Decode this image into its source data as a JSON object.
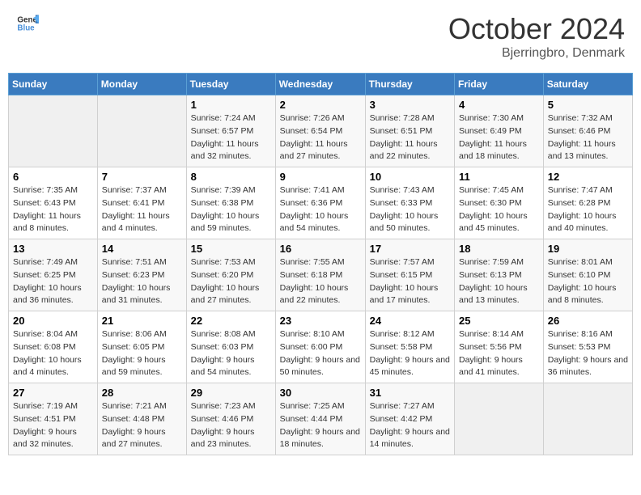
{
  "header": {
    "logo_general": "General",
    "logo_blue": "Blue",
    "month": "October 2024",
    "location": "Bjerringbro, Denmark"
  },
  "weekdays": [
    "Sunday",
    "Monday",
    "Tuesday",
    "Wednesday",
    "Thursday",
    "Friday",
    "Saturday"
  ],
  "weeks": [
    [
      {
        "day": "",
        "sunrise": "",
        "sunset": "",
        "daylight": ""
      },
      {
        "day": "",
        "sunrise": "",
        "sunset": "",
        "daylight": ""
      },
      {
        "day": "1",
        "sunrise": "Sunrise: 7:24 AM",
        "sunset": "Sunset: 6:57 PM",
        "daylight": "Daylight: 11 hours and 32 minutes."
      },
      {
        "day": "2",
        "sunrise": "Sunrise: 7:26 AM",
        "sunset": "Sunset: 6:54 PM",
        "daylight": "Daylight: 11 hours and 27 minutes."
      },
      {
        "day": "3",
        "sunrise": "Sunrise: 7:28 AM",
        "sunset": "Sunset: 6:51 PM",
        "daylight": "Daylight: 11 hours and 22 minutes."
      },
      {
        "day": "4",
        "sunrise": "Sunrise: 7:30 AM",
        "sunset": "Sunset: 6:49 PM",
        "daylight": "Daylight: 11 hours and 18 minutes."
      },
      {
        "day": "5",
        "sunrise": "Sunrise: 7:32 AM",
        "sunset": "Sunset: 6:46 PM",
        "daylight": "Daylight: 11 hours and 13 minutes."
      }
    ],
    [
      {
        "day": "6",
        "sunrise": "Sunrise: 7:35 AM",
        "sunset": "Sunset: 6:43 PM",
        "daylight": "Daylight: 11 hours and 8 minutes."
      },
      {
        "day": "7",
        "sunrise": "Sunrise: 7:37 AM",
        "sunset": "Sunset: 6:41 PM",
        "daylight": "Daylight: 11 hours and 4 minutes."
      },
      {
        "day": "8",
        "sunrise": "Sunrise: 7:39 AM",
        "sunset": "Sunset: 6:38 PM",
        "daylight": "Daylight: 10 hours and 59 minutes."
      },
      {
        "day": "9",
        "sunrise": "Sunrise: 7:41 AM",
        "sunset": "Sunset: 6:36 PM",
        "daylight": "Daylight: 10 hours and 54 minutes."
      },
      {
        "day": "10",
        "sunrise": "Sunrise: 7:43 AM",
        "sunset": "Sunset: 6:33 PM",
        "daylight": "Daylight: 10 hours and 50 minutes."
      },
      {
        "day": "11",
        "sunrise": "Sunrise: 7:45 AM",
        "sunset": "Sunset: 6:30 PM",
        "daylight": "Daylight: 10 hours and 45 minutes."
      },
      {
        "day": "12",
        "sunrise": "Sunrise: 7:47 AM",
        "sunset": "Sunset: 6:28 PM",
        "daylight": "Daylight: 10 hours and 40 minutes."
      }
    ],
    [
      {
        "day": "13",
        "sunrise": "Sunrise: 7:49 AM",
        "sunset": "Sunset: 6:25 PM",
        "daylight": "Daylight: 10 hours and 36 minutes."
      },
      {
        "day": "14",
        "sunrise": "Sunrise: 7:51 AM",
        "sunset": "Sunset: 6:23 PM",
        "daylight": "Daylight: 10 hours and 31 minutes."
      },
      {
        "day": "15",
        "sunrise": "Sunrise: 7:53 AM",
        "sunset": "Sunset: 6:20 PM",
        "daylight": "Daylight: 10 hours and 27 minutes."
      },
      {
        "day": "16",
        "sunrise": "Sunrise: 7:55 AM",
        "sunset": "Sunset: 6:18 PM",
        "daylight": "Daylight: 10 hours and 22 minutes."
      },
      {
        "day": "17",
        "sunrise": "Sunrise: 7:57 AM",
        "sunset": "Sunset: 6:15 PM",
        "daylight": "Daylight: 10 hours and 17 minutes."
      },
      {
        "day": "18",
        "sunrise": "Sunrise: 7:59 AM",
        "sunset": "Sunset: 6:13 PM",
        "daylight": "Daylight: 10 hours and 13 minutes."
      },
      {
        "day": "19",
        "sunrise": "Sunrise: 8:01 AM",
        "sunset": "Sunset: 6:10 PM",
        "daylight": "Daylight: 10 hours and 8 minutes."
      }
    ],
    [
      {
        "day": "20",
        "sunrise": "Sunrise: 8:04 AM",
        "sunset": "Sunset: 6:08 PM",
        "daylight": "Daylight: 10 hours and 4 minutes."
      },
      {
        "day": "21",
        "sunrise": "Sunrise: 8:06 AM",
        "sunset": "Sunset: 6:05 PM",
        "daylight": "Daylight: 9 hours and 59 minutes."
      },
      {
        "day": "22",
        "sunrise": "Sunrise: 8:08 AM",
        "sunset": "Sunset: 6:03 PM",
        "daylight": "Daylight: 9 hours and 54 minutes."
      },
      {
        "day": "23",
        "sunrise": "Sunrise: 8:10 AM",
        "sunset": "Sunset: 6:00 PM",
        "daylight": "Daylight: 9 hours and 50 minutes."
      },
      {
        "day": "24",
        "sunrise": "Sunrise: 8:12 AM",
        "sunset": "Sunset: 5:58 PM",
        "daylight": "Daylight: 9 hours and 45 minutes."
      },
      {
        "day": "25",
        "sunrise": "Sunrise: 8:14 AM",
        "sunset": "Sunset: 5:56 PM",
        "daylight": "Daylight: 9 hours and 41 minutes."
      },
      {
        "day": "26",
        "sunrise": "Sunrise: 8:16 AM",
        "sunset": "Sunset: 5:53 PM",
        "daylight": "Daylight: 9 hours and 36 minutes."
      }
    ],
    [
      {
        "day": "27",
        "sunrise": "Sunrise: 7:19 AM",
        "sunset": "Sunset: 4:51 PM",
        "daylight": "Daylight: 9 hours and 32 minutes."
      },
      {
        "day": "28",
        "sunrise": "Sunrise: 7:21 AM",
        "sunset": "Sunset: 4:48 PM",
        "daylight": "Daylight: 9 hours and 27 minutes."
      },
      {
        "day": "29",
        "sunrise": "Sunrise: 7:23 AM",
        "sunset": "Sunset: 4:46 PM",
        "daylight": "Daylight: 9 hours and 23 minutes."
      },
      {
        "day": "30",
        "sunrise": "Sunrise: 7:25 AM",
        "sunset": "Sunset: 4:44 PM",
        "daylight": "Daylight: 9 hours and 18 minutes."
      },
      {
        "day": "31",
        "sunrise": "Sunrise: 7:27 AM",
        "sunset": "Sunset: 4:42 PM",
        "daylight": "Daylight: 9 hours and 14 minutes."
      },
      {
        "day": "",
        "sunrise": "",
        "sunset": "",
        "daylight": ""
      },
      {
        "day": "",
        "sunrise": "",
        "sunset": "",
        "daylight": ""
      }
    ]
  ]
}
